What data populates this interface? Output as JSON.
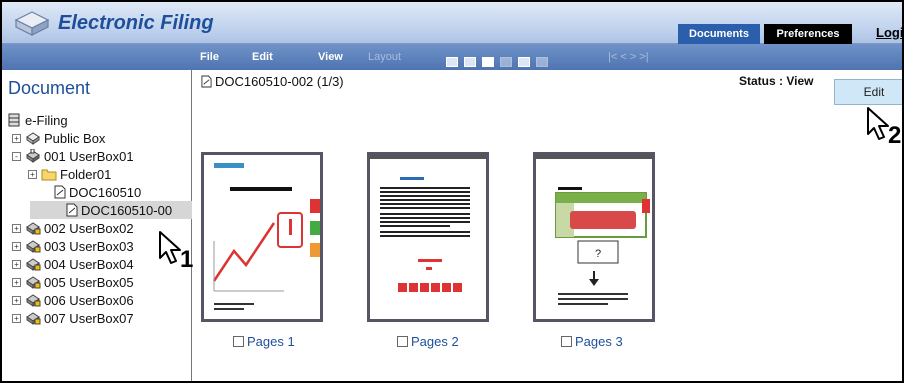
{
  "header": {
    "app_title": "Electronic Filing",
    "documents_label": "Documents",
    "preferences_label": "Preferences",
    "logout_label": "Logi"
  },
  "menu": {
    "file": "File",
    "edit": "Edit",
    "view": "View",
    "layout": "Layout",
    "nav": "|<  <  >  >|"
  },
  "sidebar": {
    "heading": "Document",
    "root": "e-Filing",
    "items": [
      {
        "label": "Public Box",
        "expander": "+",
        "icon": "public-box-icon"
      },
      {
        "label": "001 UserBox01",
        "expander": "-",
        "icon": "user-box-icon"
      },
      {
        "label": "Folder01",
        "expander": "+",
        "icon": "folder-icon"
      },
      {
        "label": "DOC160510",
        "icon": "document-icon"
      },
      {
        "label": "DOC160510-00",
        "icon": "document-icon",
        "selected": true
      },
      {
        "label": "002 UserBox02",
        "expander": "+",
        "icon": "locked-box-icon"
      },
      {
        "label": "003 UserBox03",
        "expander": "+",
        "icon": "locked-box-icon"
      },
      {
        "label": "004 UserBox04",
        "expander": "+",
        "icon": "locked-box-icon"
      },
      {
        "label": "005 UserBox05",
        "expander": "+",
        "icon": "locked-box-icon"
      },
      {
        "label": "006 UserBox06",
        "expander": "+",
        "icon": "locked-box-icon"
      },
      {
        "label": "007 UserBox07",
        "expander": "+",
        "icon": "locked-box-icon"
      }
    ]
  },
  "main": {
    "doc_title": "DOC160510-002  (1/3)",
    "status": "Status : View",
    "edit_label": "Edit",
    "pages": [
      "Pages 1",
      "Pages 2",
      "Pages 3"
    ]
  },
  "callouts": {
    "one": "1",
    "two": "2"
  },
  "colors": {
    "accent": "#2b5fab",
    "toolbar": "#4f74b0",
    "edit_button": "#cfe7f7"
  }
}
